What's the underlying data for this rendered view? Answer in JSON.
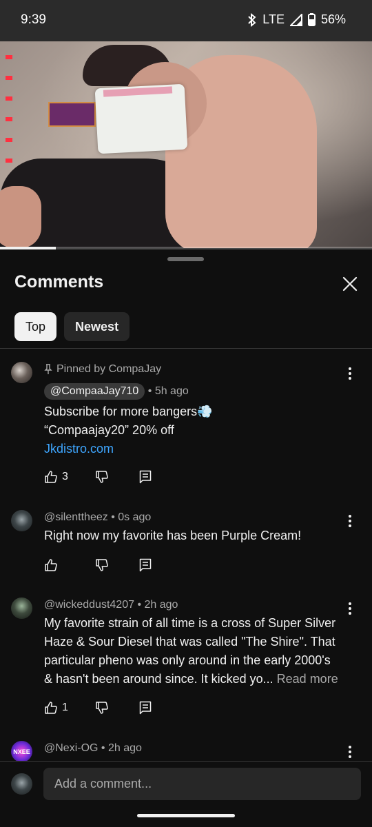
{
  "status_bar": {
    "time": "9:39",
    "network": "LTE",
    "battery": "56%"
  },
  "video": {
    "progress_fraction": 0.15
  },
  "sheet": {
    "title": "Comments",
    "tabs": [
      {
        "label": "Top",
        "active": true
      },
      {
        "label": "Newest",
        "active": false
      }
    ]
  },
  "comments": [
    {
      "pinned_text": "Pinned by CompaJay",
      "handle": "@CompaaJay710",
      "time": "5h ago",
      "lines": [
        "Subscribe for more bangers💨",
        "“Compaajay20” 20% off"
      ],
      "link": "Jkdistro.com",
      "likes": "3"
    },
    {
      "handle": "@silenttheez",
      "time": "0s ago",
      "lines": [
        "Right now my favorite has been Purple Cream!"
      ],
      "likes": ""
    },
    {
      "handle": "@wickeddust4207",
      "time": "2h ago",
      "lines": [
        "My favorite strain of all time is a cross of Super Silver",
        "Haze & Sour Diesel that was called \"The Shire\". That",
        "particular pheno was only around in the early 2000's",
        "& hasn't been around since.  It kicked yo..."
      ],
      "read_more": "Read more",
      "likes": "1"
    },
    {
      "handle": "@Nexi-OG",
      "time": "2h ago",
      "avatar_text": "NXEE"
    }
  ],
  "composer": {
    "placeholder": "Add a comment..."
  },
  "colors": {
    "link": "#3ea6ff",
    "background": "#0f0f0f",
    "chip_inactive": "#272727"
  }
}
